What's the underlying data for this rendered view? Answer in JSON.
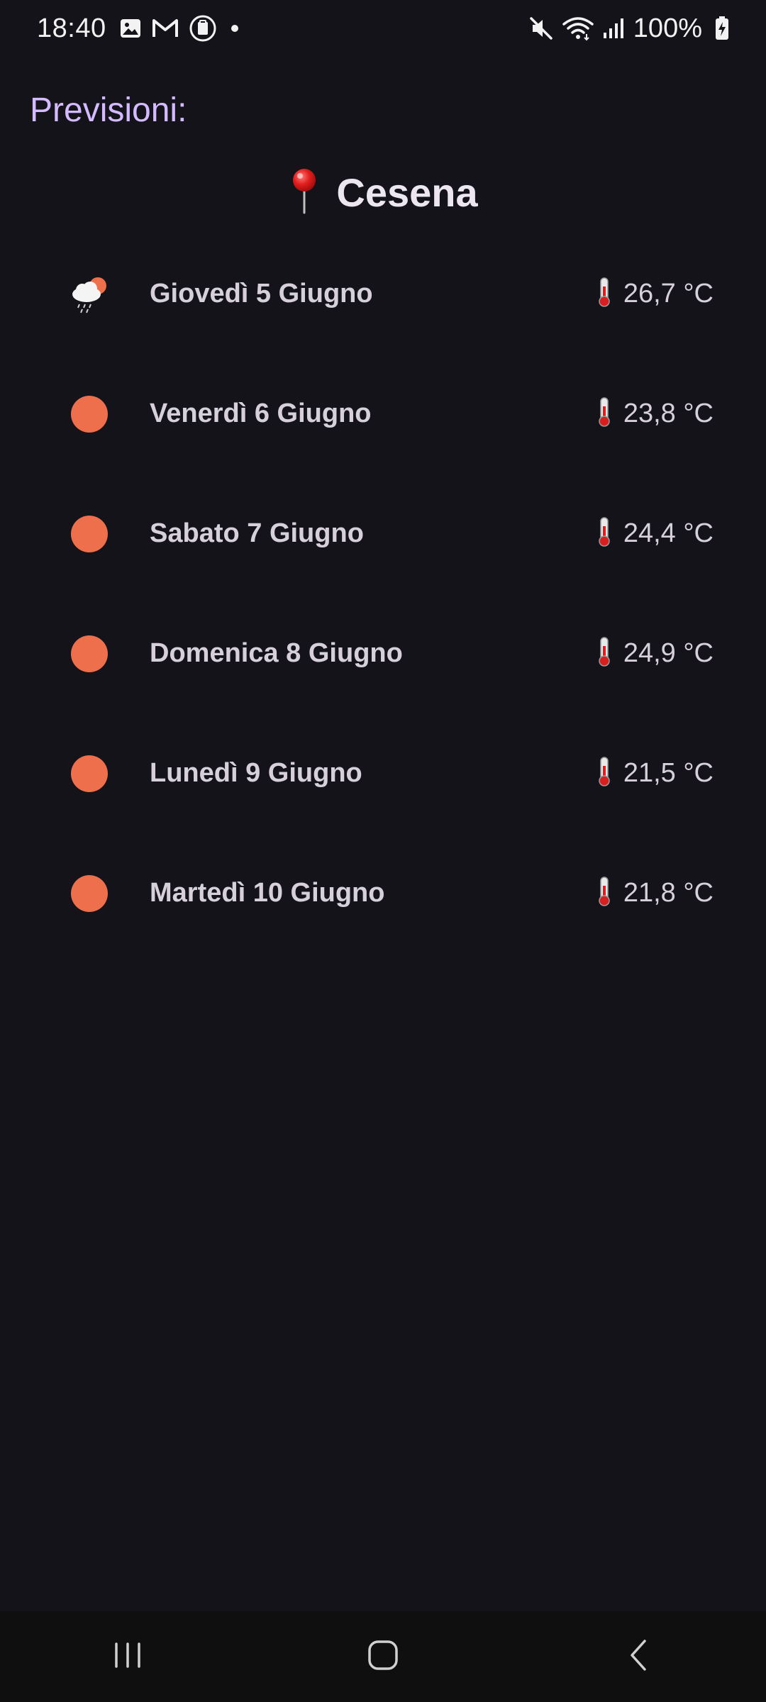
{
  "status_bar": {
    "time": "18:40",
    "battery": "100%",
    "left_icons": [
      "gallery-icon",
      "gmail-icon",
      "clipboard-icon",
      "notification-dot"
    ],
    "right_icons": [
      "mute-icon",
      "wifi-icon",
      "signal-icon",
      "battery-charging-icon"
    ]
  },
  "header": {
    "title": "Previsioni:",
    "location_icon": "pin-icon",
    "location": "Cesena"
  },
  "forecast": [
    {
      "day": "Giovedì 5 Giugno",
      "temp": "26,7 °C",
      "icon": "cloud-rain-sun-icon"
    },
    {
      "day": "Venerdì 6 Giugno",
      "temp": "23,8 °C",
      "icon": "sun-icon"
    },
    {
      "day": "Sabato 7 Giugno",
      "temp": "24,4 °C",
      "icon": "sun-icon"
    },
    {
      "day": "Domenica 8 Giugno",
      "temp": "24,9 °C",
      "icon": "sun-icon"
    },
    {
      "day": "Lunedì 9 Giugno",
      "temp": "21,5 °C",
      "icon": "sun-icon"
    },
    {
      "day": "Martedì 10 Giugno",
      "temp": "21,8 °C",
      "icon": "sun-icon"
    }
  ],
  "colors": {
    "background": "#15131a",
    "title_accent": "#d4bbff",
    "sun": "#ee6f4b",
    "text": "#d6d0da"
  },
  "nav_bar": {
    "buttons": [
      "recents-icon",
      "home-icon",
      "back-icon"
    ]
  }
}
